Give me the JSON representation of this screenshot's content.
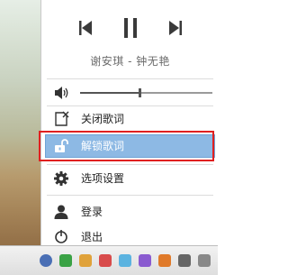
{
  "player": {
    "song": "谢安琪 - 钟无艳",
    "volume_level": 0.45
  },
  "menu": {
    "items": [
      {
        "label": "关闭歌词",
        "icon": "close-lyrics-icon"
      },
      {
        "label": "解锁歌词",
        "icon": "unlock-icon",
        "selected": true
      },
      {
        "label": "选项设置",
        "icon": "gear-icon"
      },
      {
        "label": "登录",
        "icon": "user-icon"
      },
      {
        "label": "退出",
        "icon": "exit-icon"
      }
    ]
  },
  "colors": {
    "selection": "#8db9e4",
    "annotation_border": "#e02020"
  }
}
